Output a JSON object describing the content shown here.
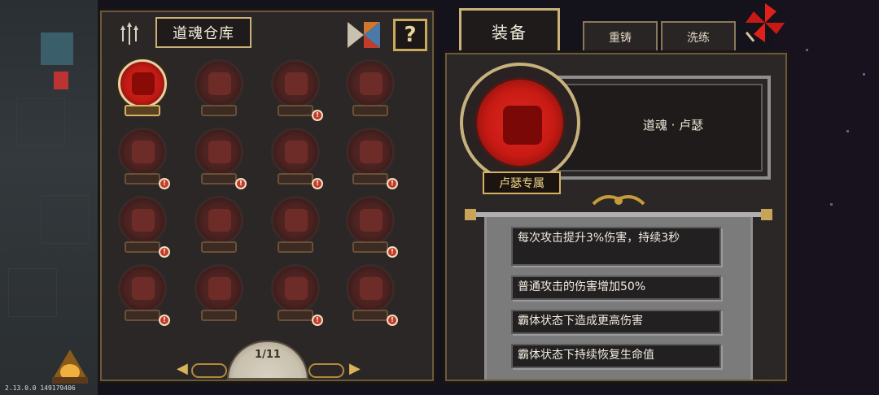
{
  "warehouse": {
    "title": "道魂仓库",
    "help_label": "?",
    "page_label": "1/11",
    "prev_label": "◀",
    "next_label": "▶",
    "slots": [
      {
        "active": true,
        "badge": false
      },
      {
        "active": false,
        "badge": false
      },
      {
        "active": false,
        "badge": true
      },
      {
        "active": false,
        "badge": false
      },
      {
        "active": false,
        "badge": true
      },
      {
        "active": false,
        "badge": true
      },
      {
        "active": false,
        "badge": true
      },
      {
        "active": false,
        "badge": true
      },
      {
        "active": false,
        "badge": true
      },
      {
        "active": false,
        "badge": false
      },
      {
        "active": false,
        "badge": false
      },
      {
        "active": false,
        "badge": true
      },
      {
        "active": false,
        "badge": true
      },
      {
        "active": false,
        "badge": false
      },
      {
        "active": false,
        "badge": true
      },
      {
        "active": false,
        "badge": true
      }
    ],
    "badge_text": "!"
  },
  "tabs": {
    "equip": "装备",
    "recast": "重铸",
    "refine": "洗练"
  },
  "equip_panel": {
    "soul_name": "道魂 · 卢瑟",
    "exclusive_tag": "卢瑟专属",
    "effects": [
      "每次攻击提升3%伤害，持续3秒",
      "普通攻击的伤害增加50%",
      "霸体状态下造成更高伤害",
      "霸体状态下持续恢复生命值"
    ]
  },
  "footer": {
    "version": "2.13.0.0 149179406"
  },
  "colors": {
    "panel_bg": "#2c2727",
    "gold_border": "#c9b27a",
    "orb_red": "#c81a14",
    "paper_gray": "#7b7b7b"
  }
}
